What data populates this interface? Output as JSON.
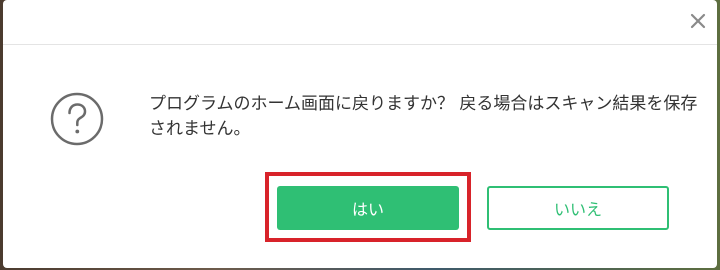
{
  "dialog": {
    "message": "プログラムのホーム画面に戻りますか？ 戻る場合はスキャン結果を保存されません。",
    "icon": "question-circle-icon",
    "close_icon": "close-icon"
  },
  "buttons": {
    "yes_label": "はい",
    "no_label": "いいえ"
  },
  "colors": {
    "accent": "#2fbf74",
    "highlight": "#d8232a",
    "text": "#333333",
    "icon": "#6b6b6b"
  }
}
